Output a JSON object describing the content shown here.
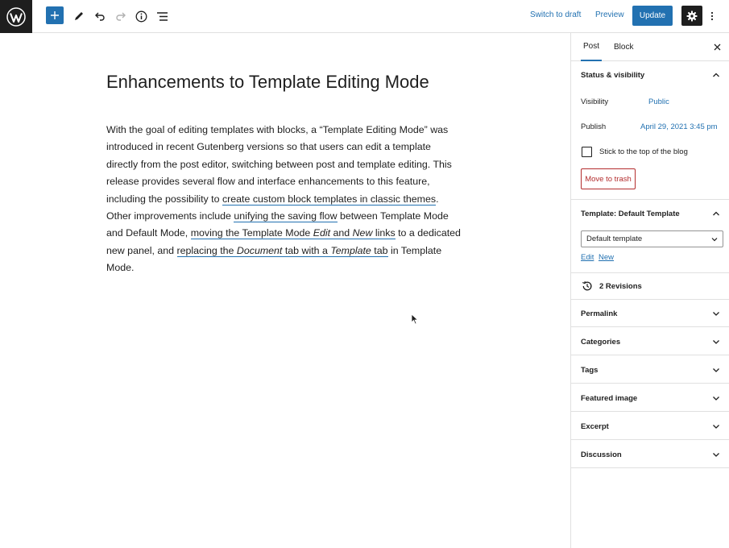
{
  "toolbar": {
    "switch_to_draft": "Switch to draft",
    "preview": "Preview",
    "update": "Update"
  },
  "post": {
    "title": "Enhancements to Template Editing Mode",
    "body": {
      "t1": "With the goal of editing templates with blocks, a “Template Editing Mode” was introduced in recent Gutenberg versions so that users can edit a template directly from the post editor, switching between post and template editing. This release provides several flow and interface enhancements to this feature, including the possibility to ",
      "link1": "create custom block templates in classic themes",
      "t2": ". Other improvements include ",
      "link2": "unifying the saving flow",
      "t3": " between Template Mode and Default Mode, ",
      "link3a": "moving the Template Mode ",
      "link3b": "Edit",
      "link3c": " and ",
      "link3d": "New",
      "link3e": " links",
      "t4": " to a dedicated new panel, and ",
      "link4a": "replacing the ",
      "link4b": "Document",
      "link4c": " tab with a ",
      "link4d": "Template",
      "link4e": " tab",
      "t5": " in Template Mode."
    }
  },
  "sidebar": {
    "tabs": [
      "Post",
      "Block"
    ],
    "status_visibility": {
      "heading": "Status & visibility",
      "visibility_label": "Visibility",
      "visibility_value": "Public",
      "publish_label": "Publish",
      "publish_value": "April 29, 2021 3:45 pm",
      "sticky_label": "Stick to the top of the blog",
      "trash_label": "Move to trash"
    },
    "template": {
      "heading": "Template: Default Template",
      "selected": "Default template",
      "edit_link": "Edit",
      "new_link": "New"
    },
    "revisions": "2 Revisions",
    "panels": [
      "Permalink",
      "Categories",
      "Tags",
      "Featured image",
      "Excerpt",
      "Discussion"
    ]
  },
  "colors": {
    "accent": "#2271b1",
    "dark": "#1e1e1e",
    "danger": "#b32d2e"
  }
}
